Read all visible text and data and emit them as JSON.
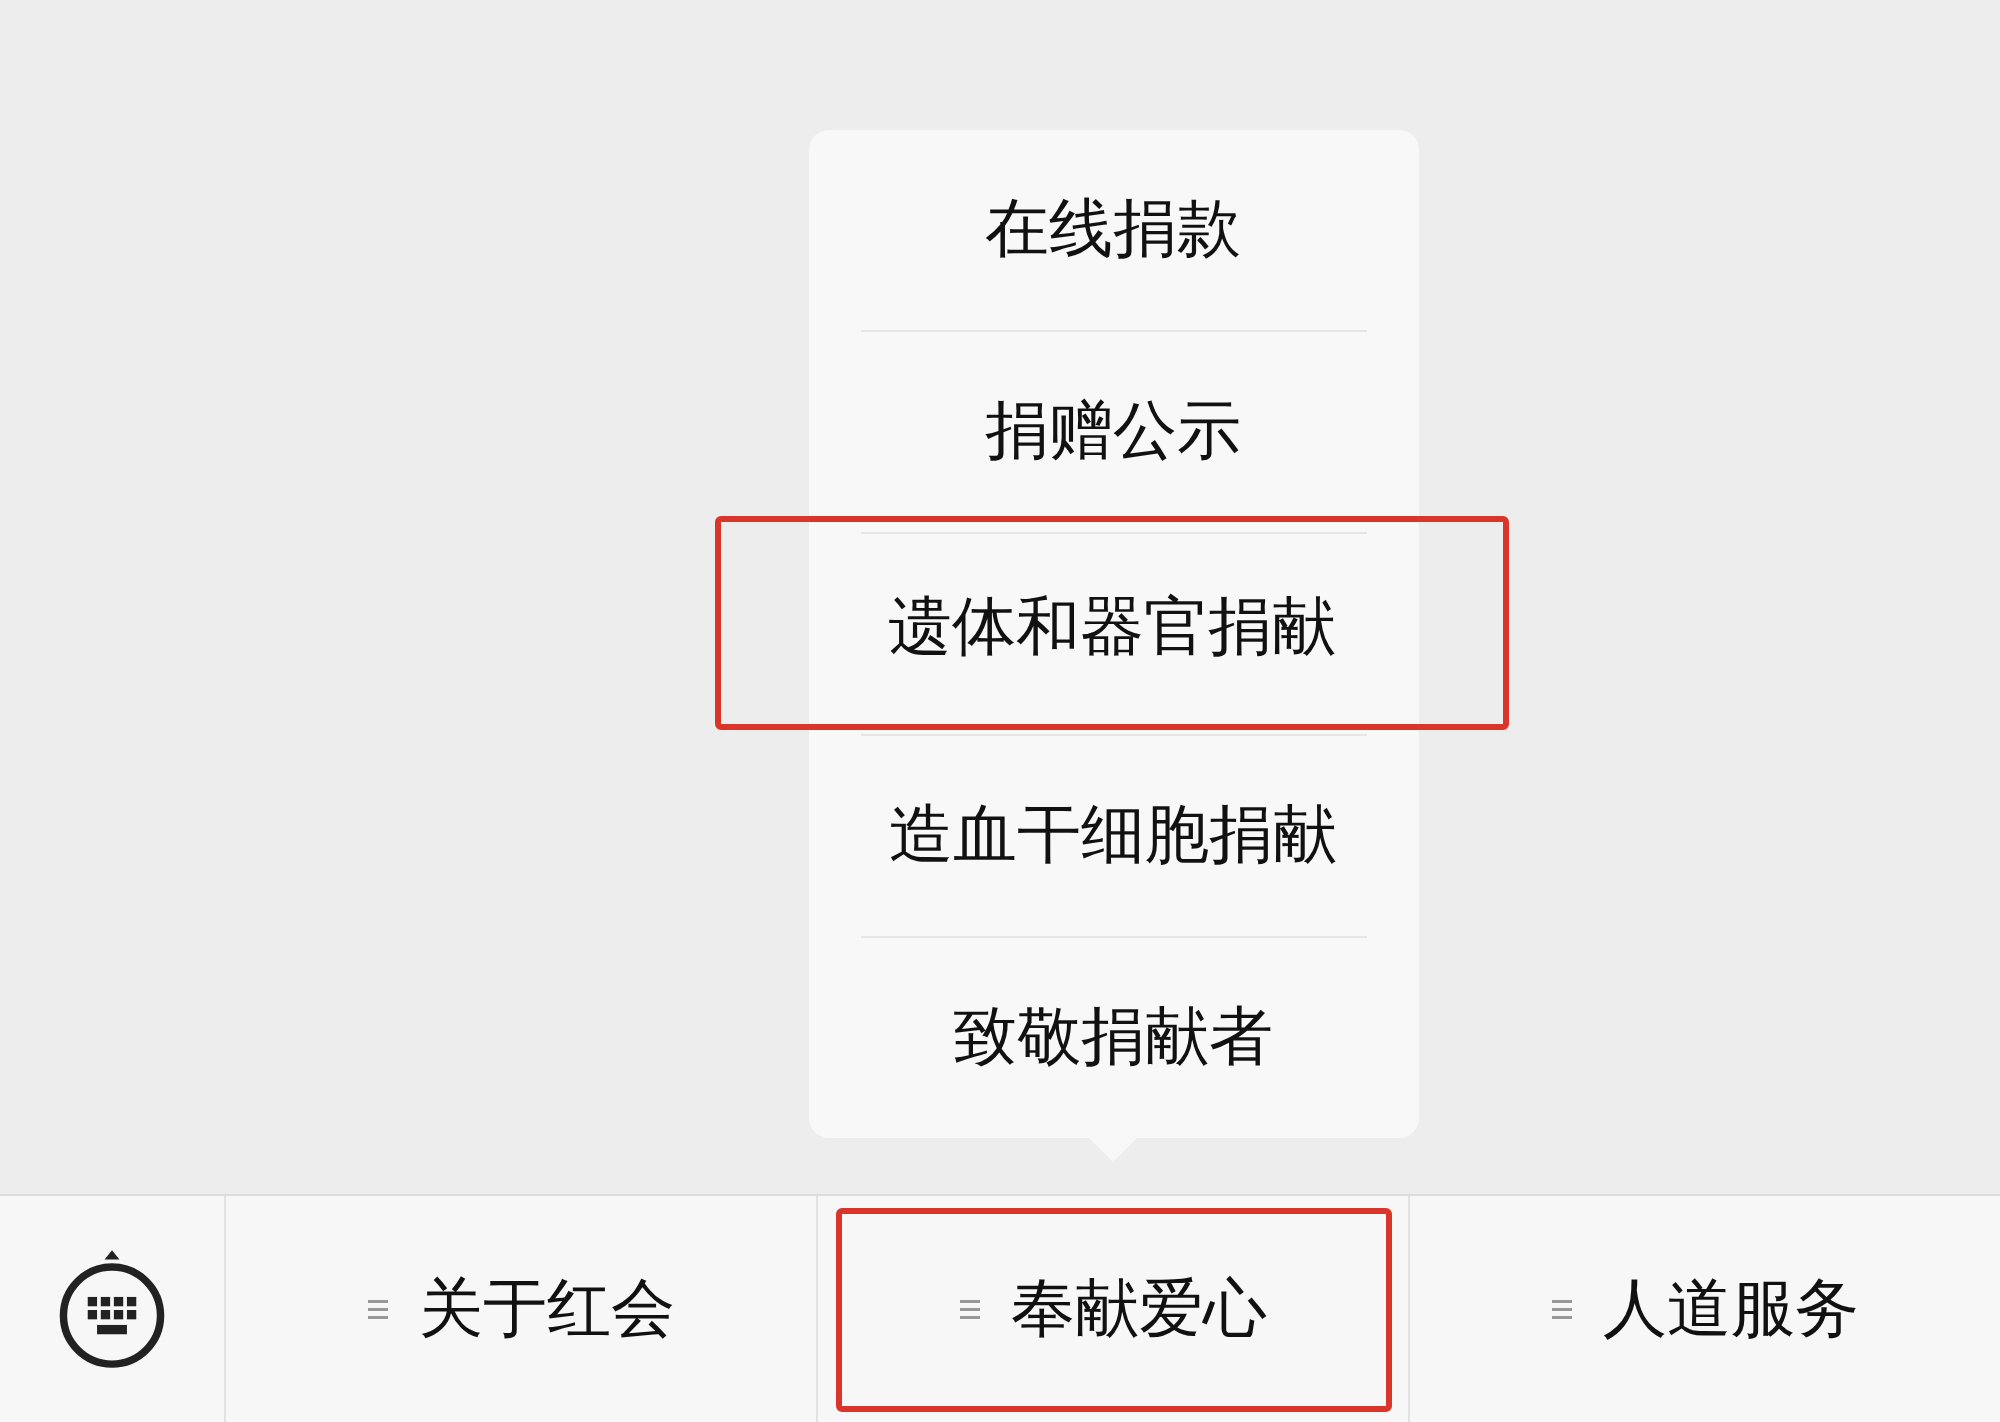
{
  "menu_tabs": [
    {
      "label": "关于红会",
      "highlighted": false
    },
    {
      "label": "奉献爱心",
      "highlighted": true,
      "submenu": [
        {
          "label": "在线捐款",
          "highlighted": false
        },
        {
          "label": "捐赠公示",
          "highlighted": false
        },
        {
          "label": "遗体和器官捐献",
          "highlighted": true
        },
        {
          "label": "造血干细胞捐献",
          "highlighted": false
        },
        {
          "label": "致敬捐献者",
          "highlighted": false
        }
      ]
    },
    {
      "label": "人道服务",
      "highlighted": false
    }
  ]
}
